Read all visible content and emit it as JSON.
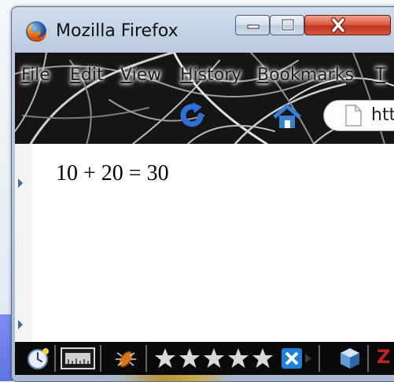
{
  "window": {
    "title": "Mozilla Firefox",
    "min_glyph": "—",
    "max_glyph": "□",
    "close_glyph": "X"
  },
  "menu": {
    "items": [
      "File",
      "Edit",
      "View",
      "History",
      "Bookmarks",
      "T"
    ]
  },
  "address": {
    "value": "htt"
  },
  "content": {
    "text": "10 + 20 = 30"
  },
  "statusbar": {
    "rating_stars": 5,
    "extra_letter": "Z"
  },
  "colors": {
    "reload": "#2f6fd8",
    "home": "#3a7fd6",
    "star": "#d9d9d9",
    "close_red": "#c0341f"
  }
}
